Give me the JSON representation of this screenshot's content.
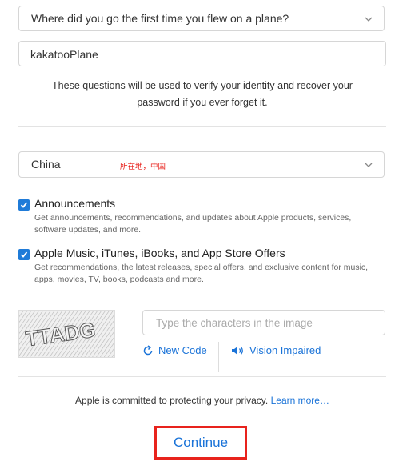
{
  "security_question": {
    "selected": "Where did you go the first time you flew on a plane?",
    "answer": "kakatooPlane"
  },
  "security_note": {
    "line1": "These questions will be used to verify your identity and recover your",
    "line2": "password if you ever forget it."
  },
  "country": {
    "selected": "China",
    "annotation": "所在地，中国"
  },
  "announcements": {
    "title": "Announcements",
    "desc_line1": "Get announcements, recommendations, and updates about Apple products, services,",
    "desc_line2": "software updates, and more.",
    "checked": true
  },
  "offers": {
    "title": "Apple Music, iTunes, iBooks, and App Store Offers",
    "desc_line1": "Get recommendations, the latest releases, special offers, and exclusive content for music,",
    "desc_line2": "apps, movies, TV, books, podcasts and more.",
    "checked": true
  },
  "captcha": {
    "image_text": "TTADG",
    "placeholder": "Type the characters in the image",
    "new_code_label": "New Code",
    "vision_impaired_label": "Vision Impaired"
  },
  "privacy": {
    "text": "Apple is committed to protecting your privacy.",
    "link": "Learn more…"
  },
  "continue_label": "Continue",
  "colors": {
    "accent": "#1a73d8",
    "checkbox": "#1f7bd8",
    "highlight_box": "#e8231d",
    "annotation": "#e8231d"
  }
}
